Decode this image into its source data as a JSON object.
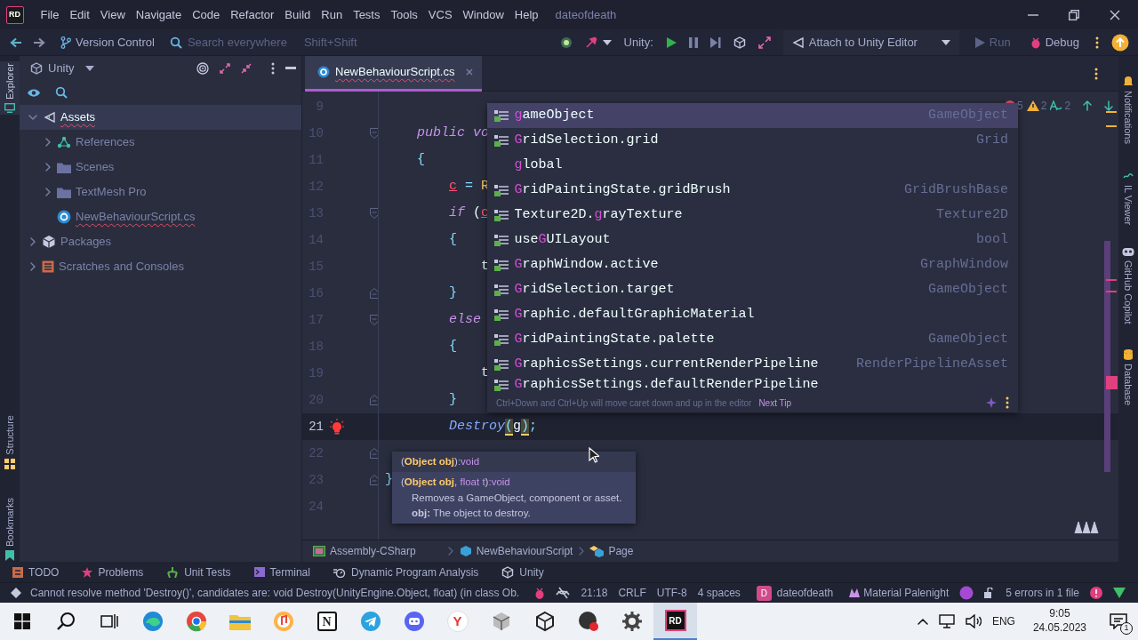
{
  "title_bar": {
    "logo": "RD",
    "menu": [
      "File",
      "Edit",
      "View",
      "Navigate",
      "Code",
      "Refactor",
      "Build",
      "Run",
      "Tests",
      "Tools",
      "VCS",
      "Window",
      "Help"
    ],
    "project": "dateofdeath"
  },
  "toolbar": {
    "version_control": "Version Control",
    "search": {
      "placeholder": "Search everywhere",
      "shortcut": "Shift+Shift"
    },
    "unity_label": "Unity:",
    "run_config": "Attach to Unity Editor",
    "actions": [
      {
        "label": "Run",
        "kind": "run",
        "disabled": true
      },
      {
        "label": "Debug",
        "kind": "debug",
        "disabled": false
      }
    ]
  },
  "left_tools": [
    {
      "label": "Explorer",
      "kind": "explorer",
      "selected": true
    },
    {
      "label": "Structure",
      "kind": "structure",
      "selected": false
    },
    {
      "label": "Bookmarks",
      "kind": "bookmarks",
      "selected": false
    }
  ],
  "right_tools": [
    {
      "label": "Notifications",
      "kind": "bell"
    },
    {
      "label": "IL Viewer",
      "kind": "il"
    },
    {
      "label": "GitHub Copilot",
      "kind": "copilot"
    },
    {
      "label": "Database",
      "kind": "database"
    }
  ],
  "explorer": {
    "view": "Unity",
    "tree": [
      {
        "label": "Assets",
        "kind": "unity",
        "expanded": true,
        "selected": true,
        "error": true,
        "children": [
          {
            "label": "References",
            "kind": "references",
            "expanded": false,
            "selected": false,
            "error": false
          },
          {
            "label": "Scenes",
            "kind": "folder",
            "expanded": false,
            "selected": false,
            "error": false
          },
          {
            "label": "TextMesh Pro",
            "kind": "folder",
            "expanded": false,
            "selected": false,
            "error": false
          },
          {
            "label": "NewBehaviourScript.cs",
            "kind": "csharp",
            "selected": false,
            "error": true
          }
        ]
      },
      {
        "label": "Packages",
        "kind": "packages",
        "expanded": false,
        "selected": false,
        "error": false
      },
      {
        "label": "Scratches and Consoles",
        "kind": "scratches",
        "expanded": false,
        "selected": false,
        "error": false
      }
    ]
  },
  "editor": {
    "tabs": [
      {
        "label": "NewBehaviourScript.cs",
        "selected": true
      }
    ],
    "inspections": [
      {
        "kind": "error",
        "count": "5"
      },
      {
        "kind": "warning",
        "count": "2"
      },
      {
        "kind": "typo",
        "count": "2"
      }
    ],
    "lines": [
      {
        "number": "9",
        "current": false
      },
      {
        "number": "10",
        "current": false,
        "kind": "member",
        "gutter": [
          {
            "kind": "fold_start"
          }
        ],
        "tokens": [
          {
            "text": "public vo",
            "kind": "keyword"
          }
        ]
      },
      {
        "number": "11",
        "current": false,
        "kind": "member",
        "tokens": [
          {
            "text": "{",
            "kind": "brace"
          }
        ]
      },
      {
        "number": "12",
        "current": false,
        "kind": "body",
        "tokens": [
          {
            "text": "c",
            "kind": "unresolved"
          },
          {
            "text": " = ",
            "kind": "brace"
          },
          {
            "text": "R",
            "kind": "type"
          }
        ]
      },
      {
        "number": "13",
        "current": false,
        "kind": "body",
        "gutter": [
          {
            "kind": "fold_start"
          }
        ],
        "tokens": [
          {
            "text": "if",
            "kind": "keyword"
          },
          {
            "text": " (",
            "kind": "plain"
          },
          {
            "text": "c",
            "kind": "unresolved"
          }
        ]
      },
      {
        "number": "14",
        "current": false,
        "kind": "body",
        "tokens": [
          {
            "text": "{",
            "kind": "brace"
          }
        ]
      },
      {
        "number": "15",
        "current": false,
        "kind": "nested",
        "tokens": [
          {
            "text": "t",
            "kind": "plain"
          }
        ]
      },
      {
        "number": "16",
        "current": false,
        "kind": "body",
        "gutter": [
          {
            "kind": "fold_end"
          }
        ],
        "tokens": [
          {
            "text": "}",
            "kind": "brace"
          }
        ]
      },
      {
        "number": "17",
        "current": false,
        "kind": "body",
        "gutter": [
          {
            "kind": "fold_start"
          }
        ],
        "tokens": [
          {
            "text": "else",
            "kind": "keyword"
          }
        ]
      },
      {
        "number": "18",
        "current": false,
        "kind": "body",
        "tokens": [
          {
            "text": "{",
            "kind": "brace"
          }
        ]
      },
      {
        "number": "19",
        "current": false,
        "kind": "nested",
        "tokens": [
          {
            "text": "t",
            "kind": "plain"
          }
        ]
      },
      {
        "number": "20",
        "current": false,
        "kind": "body",
        "gutter": [
          {
            "kind": "fold_end"
          }
        ],
        "tokens": [
          {
            "text": "}",
            "kind": "brace"
          }
        ]
      },
      {
        "number": "21",
        "current": true,
        "kind": "body",
        "gutter": [
          {
            "kind": "bulb"
          }
        ],
        "tokens": [
          {
            "text": "Destroy",
            "kind": "method"
          },
          {
            "text": "(",
            "kind": "paren"
          },
          {
            "text": "g",
            "kind": "plain"
          },
          {
            "text": ")",
            "kind": "paren"
          },
          {
            "text": ";",
            "kind": "brace"
          }
        ]
      },
      {
        "number": "22",
        "current": false,
        "gutter": [
          {
            "kind": "fold_end"
          }
        ]
      },
      {
        "number": "23",
        "current": false,
        "kind": "class",
        "gutter": [
          {
            "kind": "fold_end"
          }
        ],
        "tokens": [
          {
            "text": "}",
            "kind": "brace"
          }
        ]
      },
      {
        "number": "24",
        "current": false
      }
    ],
    "completion": {
      "items": [
        {
          "kind": "property",
          "match": "g",
          "suffix": "ameObject",
          "type": "GameObject",
          "selected": true
        },
        {
          "kind": "property",
          "match": "G",
          "suffix": "ridSelection.grid",
          "type": "Grid",
          "selected": false
        },
        {
          "kind": "keyword",
          "match": "g",
          "suffix": "lobal",
          "selected": false
        },
        {
          "kind": "property",
          "match": "G",
          "suffix": "ridPaintingState.gridBrush",
          "type": "GridBrushBase",
          "selected": false
        },
        {
          "kind": "property",
          "prefix": "Texture2D.",
          "match": "g",
          "suffix": "rayTexture",
          "type": "Texture2D",
          "selected": false
        },
        {
          "kind": "property",
          "prefix": "use",
          "match": "G",
          "suffix": "UILayout",
          "type": "bool",
          "selected": false
        },
        {
          "kind": "property",
          "match": "G",
          "suffix": "raphWindow.active",
          "type": "GraphWindow",
          "selected": false
        },
        {
          "kind": "property",
          "match": "G",
          "suffix": "ridSelection.target",
          "type": "GameObject",
          "selected": false
        },
        {
          "kind": "property",
          "match": "G",
          "suffix": "raphic.defaultGraphicMaterial",
          "selected": false
        },
        {
          "kind": "property",
          "match": "G",
          "suffix": "ridPaintingState.palette",
          "type": "GameObject",
          "selected": false
        },
        {
          "kind": "property",
          "match": "G",
          "suffix": "raphicsSettings.currentRenderPipeline",
          "type": "RenderPipelineAsset",
          "selected": false
        },
        {
          "kind": "property",
          "match": "G",
          "suffix": "raphicsSettings.defaultRenderPipeline",
          "selected": false
        }
      ],
      "hint": "Ctrl+Down and Ctrl+Up will move caret down and up in the editor",
      "next_tip": "Next Tip"
    },
    "parameter_info": {
      "signatures": [
        {
          "selected": false,
          "parts": [
            {
              "text": "(",
              "kind": "plain"
            },
            {
              "text": "Object obj",
              "kind": "current"
            },
            {
              "text": ")",
              "kind": "plain"
            },
            {
              "text": ":void",
              "kind": "type"
            }
          ]
        },
        {
          "selected": true,
          "parts": [
            {
              "text": "(",
              "kind": "plain"
            },
            {
              "text": "Object obj",
              "kind": "current"
            },
            {
              "text": ", ",
              "kind": "plain"
            },
            {
              "text": "float t",
              "kind": "type"
            },
            {
              "text": ")",
              "kind": "plain"
            },
            {
              "text": ":void",
              "kind": "type"
            }
          ],
          "summary": "Removes a GameObject, component or asset.",
          "param_doc": "**obj:** The object to destroy."
        }
      ]
    },
    "breadcrumbs": [
      {
        "label": "Assembly-CSharp",
        "kind": "assembly"
      },
      {
        "label": "NewBehaviourScript",
        "kind": "class"
      },
      {
        "label": "Page",
        "kind": "page"
      }
    ]
  },
  "tool_windows": [
    {
      "label": "TODO",
      "kind": "todo"
    },
    {
      "label": "Problems",
      "kind": "problems"
    },
    {
      "label": "Unit Tests",
      "kind": "tests"
    },
    {
      "label": "Terminal",
      "kind": "terminal"
    },
    {
      "label": "Dynamic Program Analysis",
      "kind": "dpa"
    },
    {
      "label": "Unity",
      "kind": "unity"
    }
  ],
  "status_bar": {
    "message": "Cannot resolve method 'Destroy()', candidates are:  void Destroy(UnityEngine.Object, float) (in class Ob.",
    "position": "21:18",
    "line_ending": "CRLF",
    "encoding": "UTF-8",
    "indent": "4 spaces",
    "project_badge": "D",
    "project": "dateofdeath",
    "theme": "Material Palenight",
    "errors": "5 errors in 1 file"
  },
  "taskbar": {
    "apps": [
      {
        "kind": "edge",
        "selected": false
      },
      {
        "kind": "chrome",
        "selected": false
      },
      {
        "kind": "files",
        "selected": false
      },
      {
        "kind": "music",
        "selected": false
      },
      {
        "kind": "notion",
        "label": "N",
        "selected": false
      },
      {
        "kind": "telegram",
        "selected": false
      },
      {
        "kind": "discord",
        "selected": false
      },
      {
        "kind": "yandex",
        "label": "Y",
        "selected": false
      },
      {
        "kind": "unityhub",
        "selected": false
      },
      {
        "kind": "unity",
        "selected": false
      },
      {
        "kind": "recorder",
        "selected": false
      },
      {
        "kind": "settings",
        "selected": false
      },
      {
        "kind": "rider",
        "label": "RD",
        "selected": true
      }
    ],
    "language": "ENG",
    "time": "9:05",
    "date": "24.05.2023",
    "notifications": "1"
  }
}
